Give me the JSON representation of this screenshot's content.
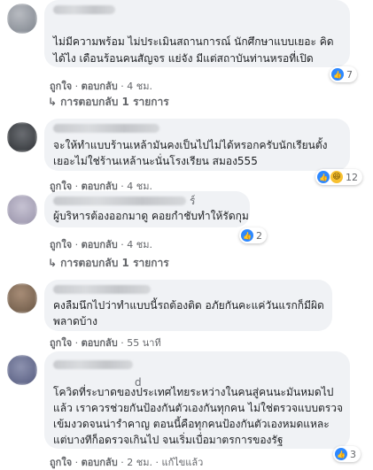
{
  "comments": [
    {
      "text_lines": [
        "ไม่มีความพร้อม ไม่ประเมินสถานการณ์ นักศึกษาแบบเยอะ คิด",
        "ได้ไง เดือนร้อนคนสัญจร แย่จัง มีแต่สถาบันท่านหรอที่เปิด"
      ],
      "reaction_count": "7",
      "like_label": "ถูกใจ",
      "reply_label": "ตอบกลับ",
      "time": "4 ชม.",
      "view_replies": "การตอบกลับ 1 รายการ"
    },
    {
      "text_lines": [
        "จะให้ทำแบบร้านเหล้ามันคงเป็นไปไม่ได้หรอกครับนักเรียนตั้ง",
        "เยอะไม่ใช่ร้านเหล้านะนั่นโรงเรียน สมอง555"
      ],
      "reaction_count": "12",
      "like_label": "ถูกใจ",
      "reply_label": "ตอบกลับ",
      "time": "4 ชม."
    },
    {
      "name_tail": "ร์",
      "text_lines": [
        "ผู้บริหารต้องออกมาดู คอยกำชับทำให้รัดกุม"
      ],
      "reaction_count": "2",
      "like_label": "ถูกใจ",
      "reply_label": "ตอบกลับ",
      "time": "4 ชม.",
      "view_replies": "การตอบกลับ 1 รายการ"
    },
    {
      "text_lines": [
        "คงลืมนึกไปว่าทำแบบนี้รถต้องติด อภัยกันคะแค่วันแรกก็มีผิด",
        "พลาดบ้าง"
      ],
      "like_label": "ถูกใจ",
      "reply_label": "ตอบกลับ",
      "time": "55 นาที"
    },
    {
      "name_tail": "d",
      "text_lines": [
        "โควิดที่ระบาดของประเทศไทยระหว่างในคนสู่คนนะมันหมดไป",
        "แล้ว เราควรช่วยกันป้องกันตัวเองกันทุกคน ไม่ใช่ตรวจแบบตรวจ",
        "เข้มงวดจนน่ารำคาญ ตอนนี้คือทุกคนป้องกันตัวเองหมดแหละ",
        "แต่บางทีก็อดรวจเกินไป จนเริ่มเบื่อมาตรการของรัฐ"
      ],
      "reaction_count": "3",
      "like_label": "ถูกใจ",
      "reply_label": "ตอบกลับ",
      "time": "2 ชม.",
      "edited": "แก้ไขแล้ว"
    }
  ],
  "colors": {
    "bubble": "#f0f2f5",
    "like": "#2d88ff",
    "meta_text": "#65676b"
  },
  "icons": [
    "like-icon",
    "haha-icon",
    "reply-arrow-icon"
  ]
}
